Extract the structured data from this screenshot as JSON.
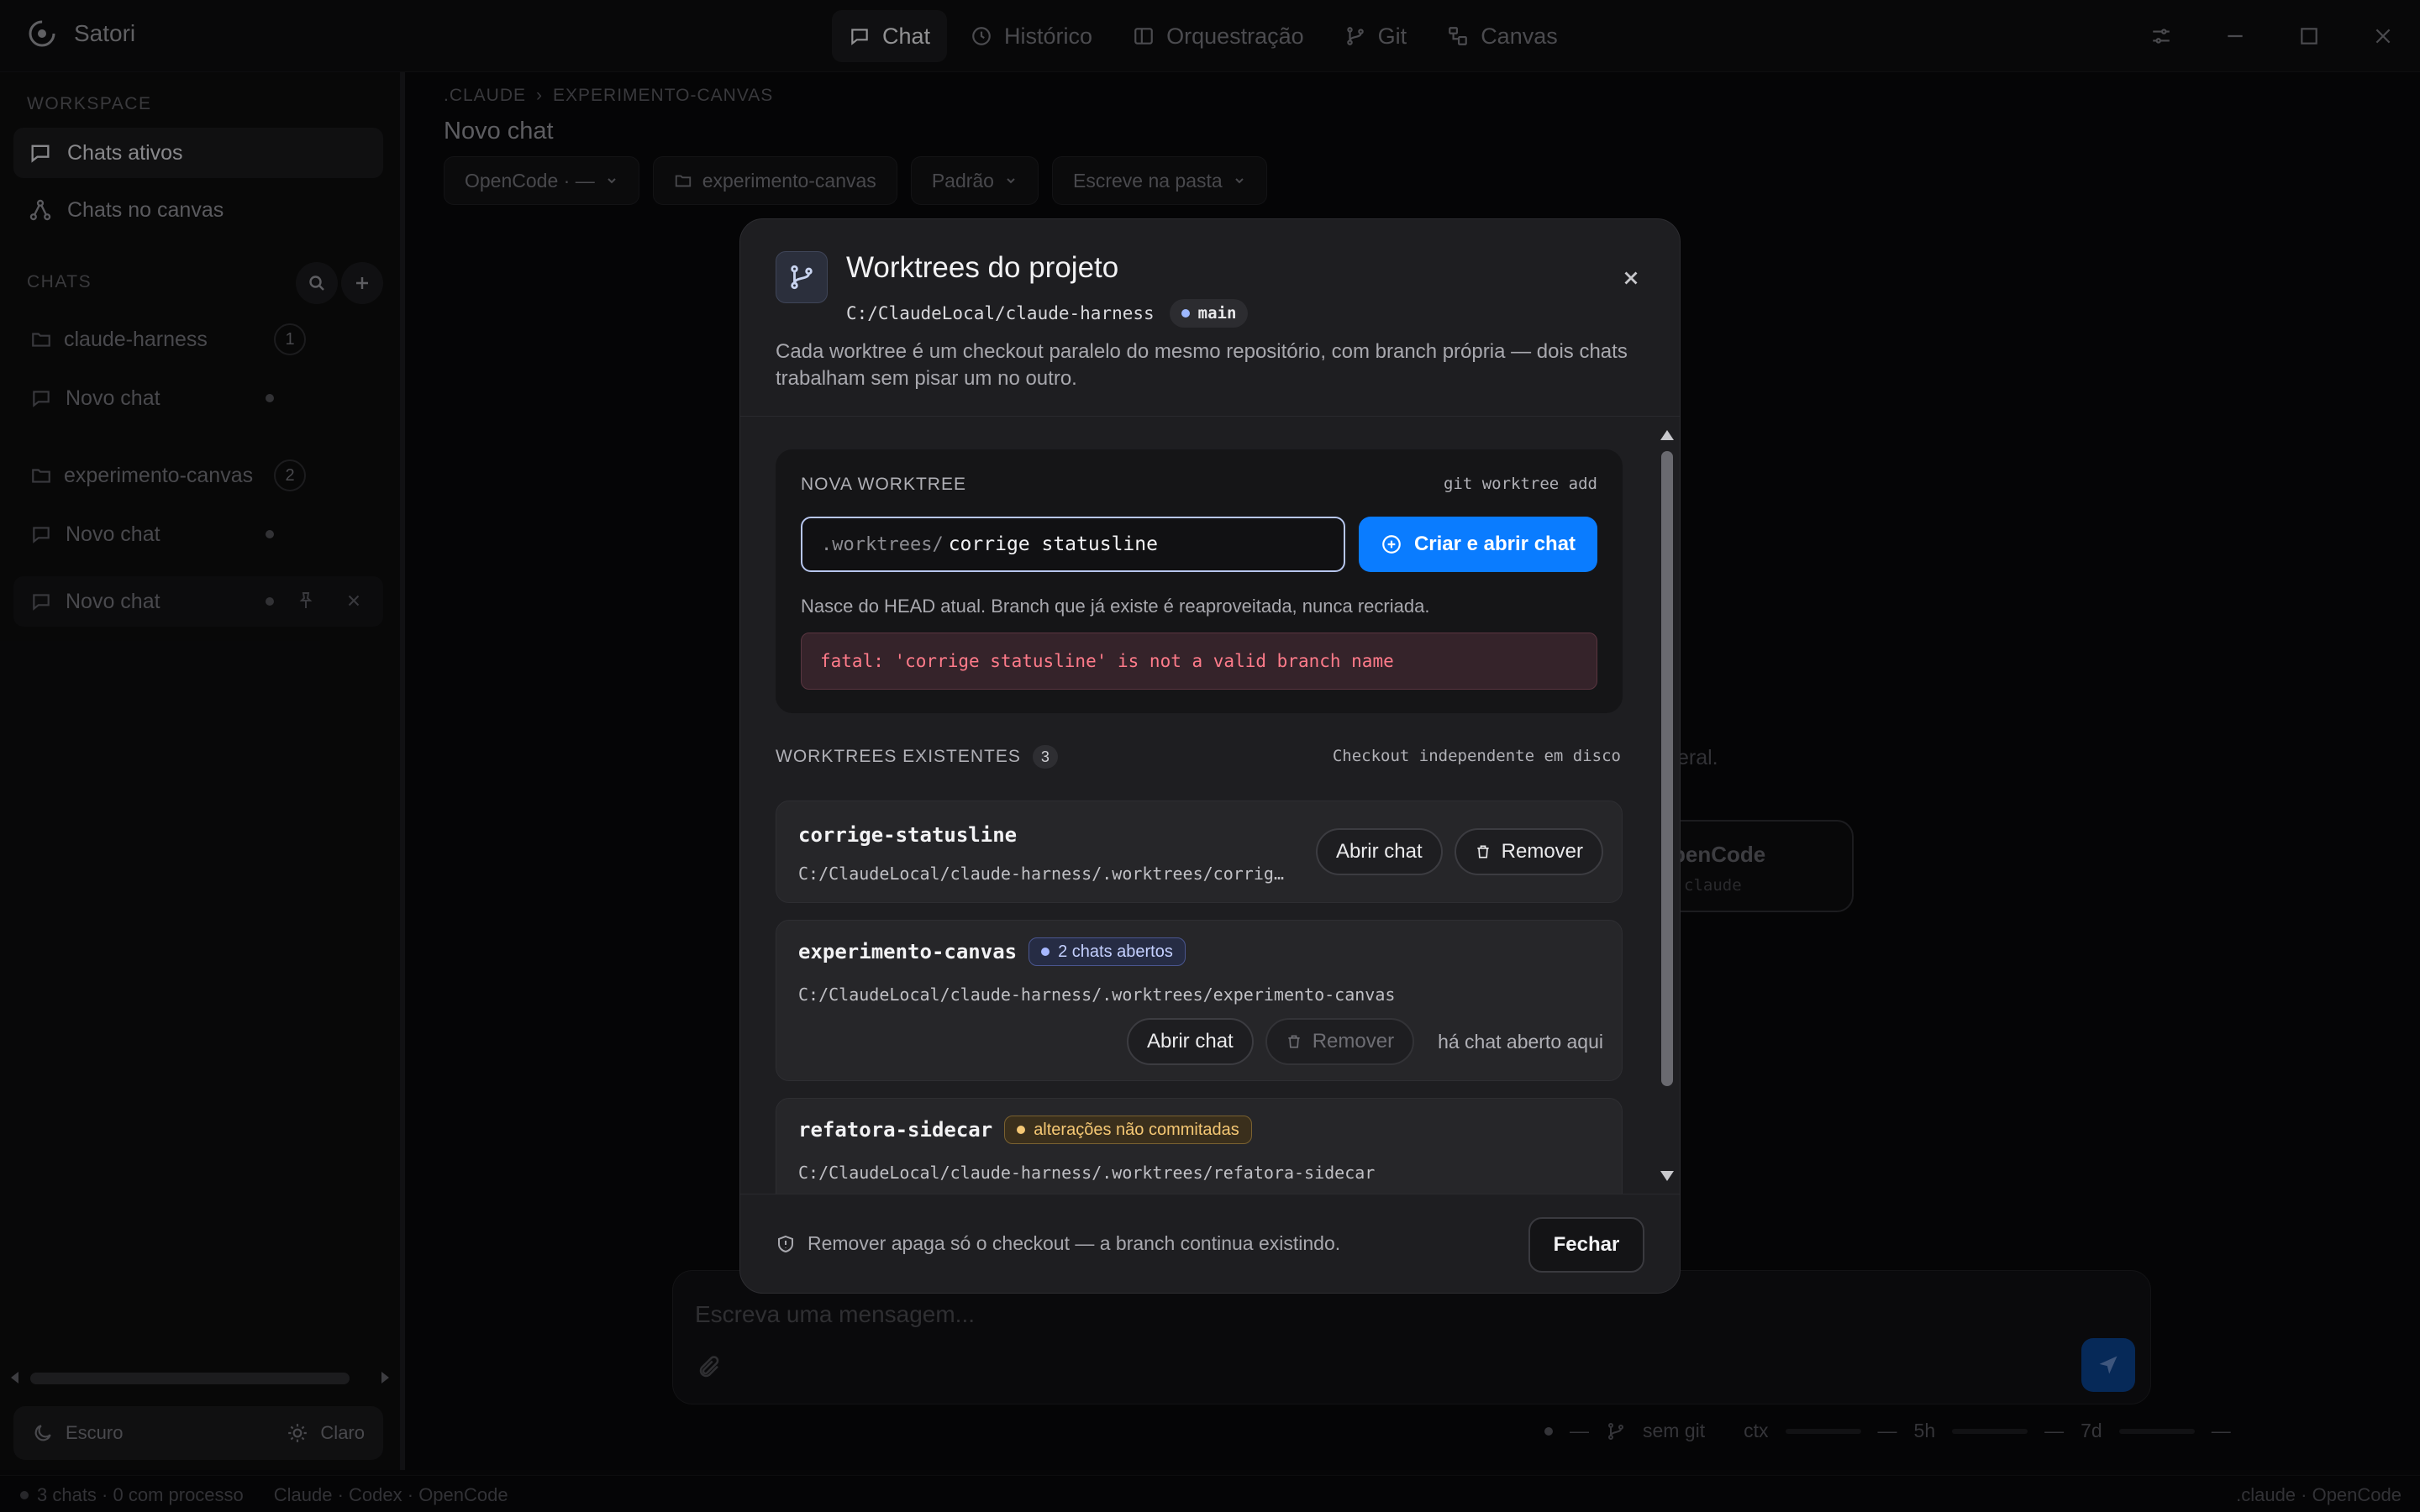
{
  "app": {
    "name": "Satori"
  },
  "topnav": [
    {
      "label": "Chat",
      "icon": "chat-bubble-icon",
      "active": true
    },
    {
      "label": "Histórico",
      "icon": "clock-icon",
      "active": false
    },
    {
      "label": "Orquestração",
      "icon": "layout-icon",
      "active": false
    },
    {
      "label": "Git",
      "icon": "git-branch-icon",
      "active": false
    },
    {
      "label": "Canvas",
      "icon": "canvas-icon",
      "active": false
    }
  ],
  "sidebar": {
    "workspace_label": "WORKSPACE",
    "items": [
      {
        "label": "Chats ativos",
        "active": true
      },
      {
        "label": "Chats no canvas",
        "active": false
      }
    ],
    "chats_label": "CHATS",
    "groups": [
      {
        "name": "claude-harness",
        "count": "1",
        "chats": [
          {
            "label": "Novo chat"
          }
        ]
      },
      {
        "name": "experimento-canvas",
        "count": "2",
        "chats": [
          {
            "label": "Novo chat"
          },
          {
            "label": "Novo chat"
          }
        ]
      }
    ],
    "theme": {
      "dark": "Escuro",
      "light": "Claro"
    }
  },
  "main": {
    "breadcrumb": [
      ".CLAUDE",
      "EXPERIMENTO-CANVAS"
    ],
    "breadcrumb_sep": "›",
    "title": "Novo chat",
    "chips": [
      {
        "label": "OpenCode · —"
      },
      {
        "label": "experimento-canvas"
      },
      {
        "label": "Padrão"
      },
      {
        "label": "Escreve na pasta"
      }
    ],
    "bg_text": "eral.",
    "bg_card": {
      "title": "penCode",
      "sub": "claude"
    },
    "composer_placeholder": "Escreva uma mensagem...",
    "status": {
      "dash": "—",
      "git": "sem git",
      "ctx": "ctx",
      "h5": "5h",
      "d7": "7d"
    }
  },
  "footer": {
    "left": "3 chats · 0 com processo",
    "providers": "Claude · Codex · OpenCode",
    "right": ".claude · OpenCode"
  },
  "modal": {
    "title": "Worktrees do projeto",
    "path": "C:/ClaudeLocal/claude-harness",
    "branch": "main",
    "description": "Cada worktree é um checkout paralelo do mesmo repositório, com branch própria — dois chats trabalham sem pisar um no outro.",
    "new_worktree": {
      "label": "NOVA WORKTREE",
      "command": "git worktree add",
      "prefix": ".worktrees/",
      "value": "corrige statusline",
      "create_button": "Criar e abrir chat",
      "hint": "Nasce do HEAD atual. Branch que já existe é reaproveitada, nunca recriada.",
      "error": "fatal: 'corrige statusline' is not a valid branch name"
    },
    "existing": {
      "label": "WORKTREES EXISTENTES",
      "count": "3",
      "note": "Checkout independente em disco",
      "items": [
        {
          "name": "corrige-statusline",
          "path": "C:/ClaudeLocal/claude-harness/.worktrees/corrige-statusline",
          "open": "Abrir chat",
          "remove": "Remover"
        },
        {
          "name": "experimento-canvas",
          "badge": "2 chats abertos",
          "path": "C:/ClaudeLocal/claude-harness/.worktrees/experimento-canvas",
          "open": "Abrir chat",
          "remove": "Remover",
          "disabled_note": "há chat aberto aqui"
        },
        {
          "name": "refatora-sidecar",
          "badge": "alterações não commitadas",
          "path": "C:/ClaudeLocal/claude-harness/.worktrees/refatora-sidecar"
        }
      ]
    },
    "footer_note": "Remover apaga só o checkout — a branch continua existindo.",
    "close_button": "Fechar"
  }
}
